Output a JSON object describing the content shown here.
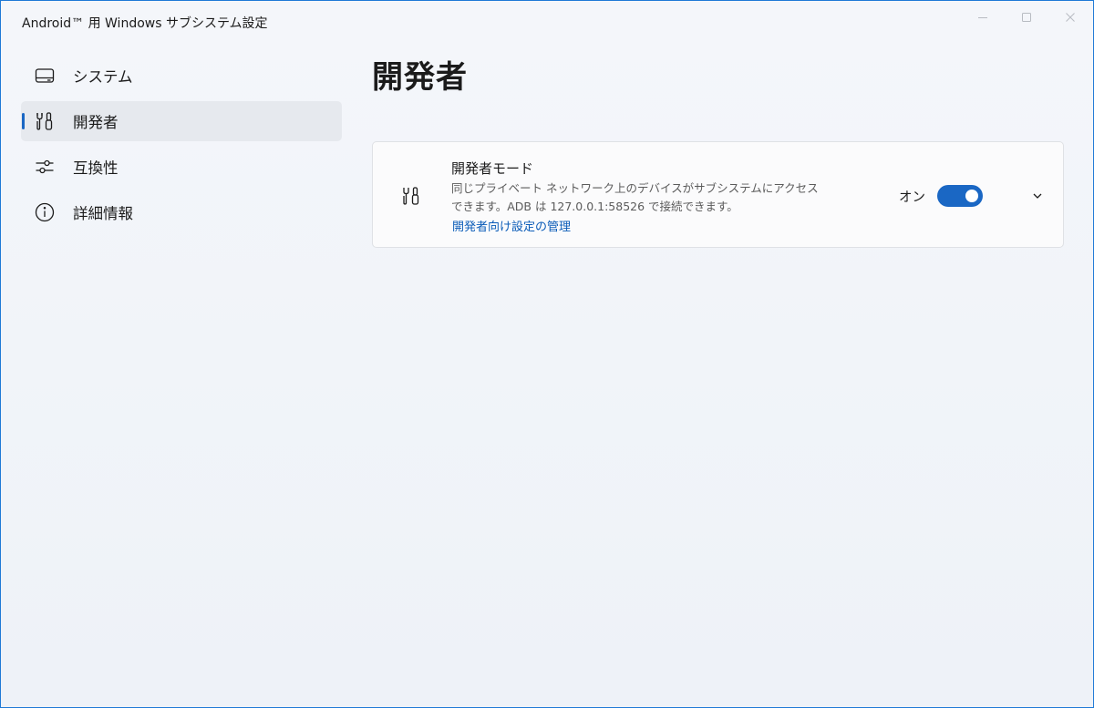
{
  "window": {
    "title": "Android™ 用 Windows サブシステム設定"
  },
  "sidebar": {
    "items": [
      {
        "label": "システム",
        "icon": "system-icon",
        "selected": false
      },
      {
        "label": "開発者",
        "icon": "developer-tools-icon",
        "selected": true
      },
      {
        "label": "互換性",
        "icon": "sliders-icon",
        "selected": false
      },
      {
        "label": "詳細情報",
        "icon": "info-icon",
        "selected": false
      }
    ]
  },
  "main": {
    "title": "開発者",
    "card": {
      "icon": "developer-tools-icon",
      "title": "開発者モード",
      "description": "同じプライベート ネットワーク上のデバイスがサブシステムにアクセスできます。ADB は 127.0.0.1:58526 で接続できます。",
      "link": "開発者向け設定の管理",
      "toggle_label": "オン",
      "toggle_on": true
    }
  },
  "colors": {
    "accent": "#1a67c4",
    "link": "#0b5cb8",
    "window_border": "#1f7ad6",
    "background": "#eff3f9"
  }
}
